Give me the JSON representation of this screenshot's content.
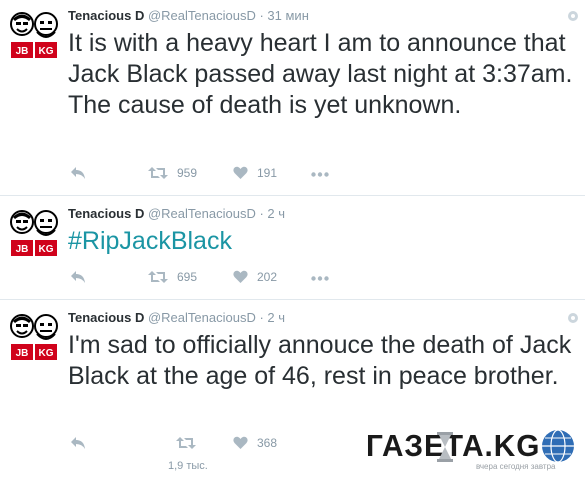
{
  "tweets": [
    {
      "display_name": "Tenacious D",
      "handle": "@RealTenaciousD",
      "time": "31 мин",
      "text": "It is with a heavy heart I am to announce that Jack Black passed away last night at 3:37am. The cause of death is yet unknown.",
      "retweets": "959",
      "likes": "191",
      "avatar_labels": [
        "JB",
        "KG"
      ]
    },
    {
      "display_name": "Tenacious D",
      "handle": "@RealTenaciousD",
      "time": "2 ч",
      "text": "#RipJackBlack",
      "retweets": "695",
      "likes": "202",
      "avatar_labels": [
        "JB",
        "KG"
      ]
    },
    {
      "display_name": "Tenacious D",
      "handle": "@RealTenaciousD",
      "time": "2 ч",
      "text": "I'm sad to officially annouce the death of Jack Black at the age of 46, rest in peace brother.",
      "retweets": "1,9 тыс.",
      "likes": "368",
      "avatar_labels": [
        "JB",
        "KG"
      ]
    }
  ],
  "separator": "·",
  "icons": {
    "reply": "reply-icon",
    "retweet": "retweet-icon",
    "like": "heart-icon",
    "more": "more-icon",
    "settings": "gear-icon"
  },
  "watermark": {
    "title": "ГАЗЕТА.KG",
    "subtitle": "вчера сегодня завтра"
  },
  "colors": {
    "name": "#292f33",
    "meta": "#8899a6",
    "action": "#aab8c2",
    "hashtag": "#1b95a4",
    "divider": "#e1e8ed",
    "avatar_badge": "#d0021b"
  }
}
